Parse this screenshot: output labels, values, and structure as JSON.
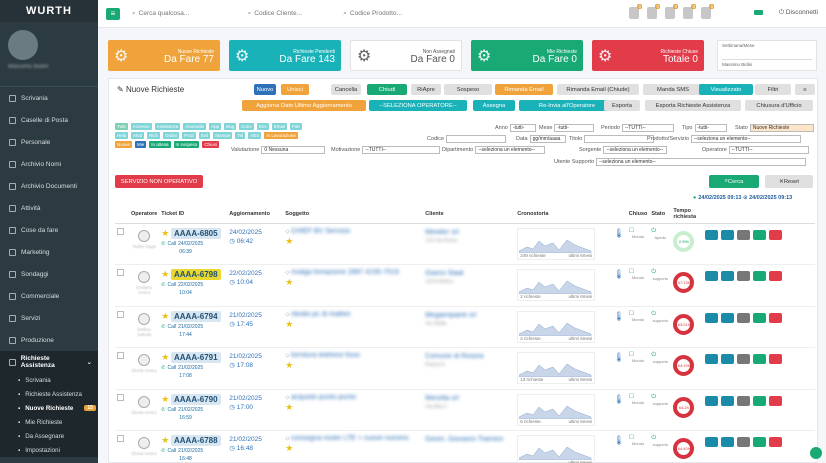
{
  "app": {
    "logo": "WURTH"
  },
  "sidebar": {
    "user_name": "Massimo Bidini",
    "items": [
      {
        "label": "Scrivania",
        "icon": "desktop-icon"
      },
      {
        "label": "Caselle di Posta",
        "icon": "mail-icon"
      },
      {
        "label": "Personale",
        "icon": "user-icon"
      },
      {
        "label": "Archivio Nomi",
        "icon": "address-book-icon"
      },
      {
        "label": "Archivio Documenti",
        "icon": "folder-icon"
      },
      {
        "label": "Attività",
        "icon": "tasks-icon"
      },
      {
        "label": "Cose da fare",
        "icon": "checklist-icon"
      },
      {
        "label": "Marketing",
        "icon": "bullhorn-icon"
      },
      {
        "label": "Sondaggi",
        "icon": "poll-icon"
      },
      {
        "label": "Commerciale",
        "icon": "chart-icon"
      },
      {
        "label": "Servizi",
        "icon": "wrench-icon"
      },
      {
        "label": "Produzione",
        "icon": "industry-icon"
      }
    ],
    "group": {
      "label": "Richieste Assistenza",
      "items": [
        {
          "label": "Scrivania"
        },
        {
          "label": "Richieste Assistenza"
        },
        {
          "label": "Nuove Richieste",
          "badge": "15"
        },
        {
          "label": "Mie Richieste"
        },
        {
          "label": "Da Assegnare"
        },
        {
          "label": "Impostazioni"
        }
      ]
    }
  },
  "topbar": {
    "search1": "Cerca qualcosa...",
    "search2": "Codice Cliente...",
    "search3": "Codice Prodotto...",
    "notifications": [
      "0",
      "0",
      "0",
      "0",
      "6"
    ],
    "logout": "Disconnetti"
  },
  "cards": [
    {
      "l1": "Nuove Richieste",
      "l2": "Da Fare 77",
      "color": "#f0a33b"
    },
    {
      "l1": "Richieste Pendenti",
      "l2": "Da Fare 143",
      "color": "#1ab2b9"
    },
    {
      "l1": "Non Assegnati",
      "l2": "Da Fare 0",
      "color": "#ffffff"
    },
    {
      "l1": "Mie Richieste",
      "l2": "Da Fare 0",
      "color": "#19a974"
    },
    {
      "l1": "Richieste Chiuse",
      "l2": "Totale 0",
      "color": "#e23b4a"
    }
  ],
  "gauge": {
    "title": "Settimana/Mese",
    "sub": "Massimo Bidini"
  },
  "panel": {
    "title": "Nuove Richieste",
    "buttons1": [
      "Nuovo",
      "Unisci",
      "Cancella",
      "Chiudi",
      "RiApre",
      "Sospeso",
      "Rimanda Email",
      "Rimanda Email (Chiude)",
      "Manda SMS",
      "Visualizzato",
      "Filtri",
      "≡"
    ],
    "buttons2": [
      "Aggiorna Dato Ultimo Aggiornamento",
      "--SELEZIONA OPERATORE--",
      "Assegna",
      "Re-Invia all'Operatore",
      "Esporta",
      "Esporta Richieste Assistenza",
      "Chiusura d'Ufficio"
    ],
    "filters": {
      "anno": "Anno",
      "anno_v": "-tutti-",
      "mese": "Mese",
      "mese_v": "-tutti-",
      "periodo": "Periodo",
      "periodo_v": "--TUTTI--",
      "tipo": "Tipo",
      "tipo_v": "-tutti-",
      "stato": "Stato",
      "stato_v": "Nuove Richieste",
      "codice": "Codice",
      "data": "Data",
      "data_v": "gg/mm/aaaa",
      "titolo": "Titolo",
      "prodotto": "Prodotto/Servizio",
      "prodotto_v": "--seleziona un elemento--",
      "valutazione": "Valutazione",
      "valutazione_v": "0 Nessuna",
      "motivazione": "Motivazione",
      "motivazione_v": "--TUTTI--",
      "dipartimento": "Dipartimento",
      "dipartimento_v": "--seleziona un elemento--",
      "sorgente": "Sorgente",
      "sorgente_v": "--seleziona un elemento--",
      "operatore": "Operatore",
      "operatore_v": "--TUTTI--",
      "utente": "Utente Supporto",
      "utente_v": "--seleziona un elemento--"
    },
    "chips": [
      "Tutti",
      "Accesso",
      "Assistenza",
      "Anomalie",
      "App",
      "Bug",
      "Cons",
      "Doc",
      "Email",
      "Fatt",
      "Help",
      "Mod",
      "Rich",
      "Ordini",
      "Prod",
      "Svil",
      "Stampe",
      "Tel",
      "Altro",
      "In Lavorazione",
      "Nuove",
      "Mie",
      "In attesa",
      "In sospeso",
      "Chiusi"
    ],
    "service_status": "SERVIZIO NON OPERATIVO",
    "search_btn": "Cerca",
    "reset_btn": "Reset",
    "date_range": "24/02/2025 09:13 ⊙ 24/02/2025 09:13"
  },
  "table": {
    "headers": [
      "",
      "Operatore",
      "Ticket ID",
      "Aggiornamento",
      "Soggetto",
      "Cliente",
      "Cronostoria",
      "",
      "Chiuso",
      "Stato",
      "Tempo richiesta",
      ""
    ],
    "rows": [
      {
        "op": "Tedim Sage",
        "ticket": "AAAA-6805",
        "hl": false,
        "call": "Call",
        "cd": "24/02/2025",
        "ct": "06:39",
        "upd_d": "24/02/2025",
        "upd_t": "06:42",
        "subj": "CHIEF BV Servizio",
        "cli1": "Mewtec srl",
        "cli2": "123 Via Roma",
        "cro": "249 richieste",
        "time": "2:59h",
        "late": false,
        "stato": "Aperto"
      },
      {
        "op": "Emilano Amico",
        "ticket": "AAAA-6798",
        "hl": true,
        "call": "Call",
        "cd": "22/02/2025",
        "ct": "10:04",
        "upd_d": "22/02/2025",
        "upd_t": "10:04",
        "subj": "rivalga fomazione 2887 4235-7519",
        "cli1": "Gianni Staal",
        "cli2": "12/14 Ardica",
        "cro": "2 richieste",
        "time": "47:13h",
        "late": true,
        "stato": "supporto"
      },
      {
        "op": "Detlive Sabola",
        "ticket": "AAAA-6794",
        "hl": false,
        "call": "Call",
        "cd": "21/02/2025",
        "ct": "17:44",
        "upd_d": "21/02/2025",
        "upd_t": "17:45",
        "subj": "ritirato pc di matteo",
        "cli1": "Megaimpianti srl",
        "cli2": "Via Stella",
        "cro": "2 richieste",
        "time": "63:01h",
        "late": true,
        "stato": "supporto"
      },
      {
        "op": "Gloria Amico",
        "ticket": "AAAA-6791",
        "hl": false,
        "call": "Call",
        "cd": "21/02/2025",
        "ct": "17:08",
        "upd_d": "21/02/2025",
        "upd_t": "17:08",
        "subj": "fornitura telefono fisso",
        "cli1": "Comune di Rosora",
        "cli2": "Piazza 8",
        "cro": "13 richieste",
        "time": "64:19h",
        "late": true,
        "stato": "supporto"
      },
      {
        "op": "Gloria Amico",
        "ticket": "AAAA-6790",
        "hl": false,
        "call": "Call",
        "cd": "21/02/2025",
        "ct": "16:59",
        "upd_d": "21/02/2025",
        "upd_t": "17:00",
        "subj": "acquisto punto punto",
        "cli1": "Mecella srl",
        "cli2": "Via Alta 3",
        "cro": "6 richieste",
        "time": "64:2h",
        "late": true,
        "stato": "supporto"
      },
      {
        "op": "Gloria Amico",
        "ticket": "AAAA-6788",
        "hl": false,
        "call": "Call",
        "cd": "21/02/2025",
        "ct": "16:48",
        "upd_d": "21/02/2025",
        "upd_t": "16:48",
        "subj": "consegna router LTE + nuove numero",
        "cli1": "Geom. Giovanni Tramoni",
        "cli2": "",
        "cro": "",
        "time": "64:40h",
        "late": true,
        "stato": "supporto"
      }
    ]
  },
  "colors": {
    "green": "#19a974",
    "orange": "#f0a33b",
    "teal": "#1ab2b9",
    "red": "#e23b4a",
    "blue": "#2e71b8"
  }
}
